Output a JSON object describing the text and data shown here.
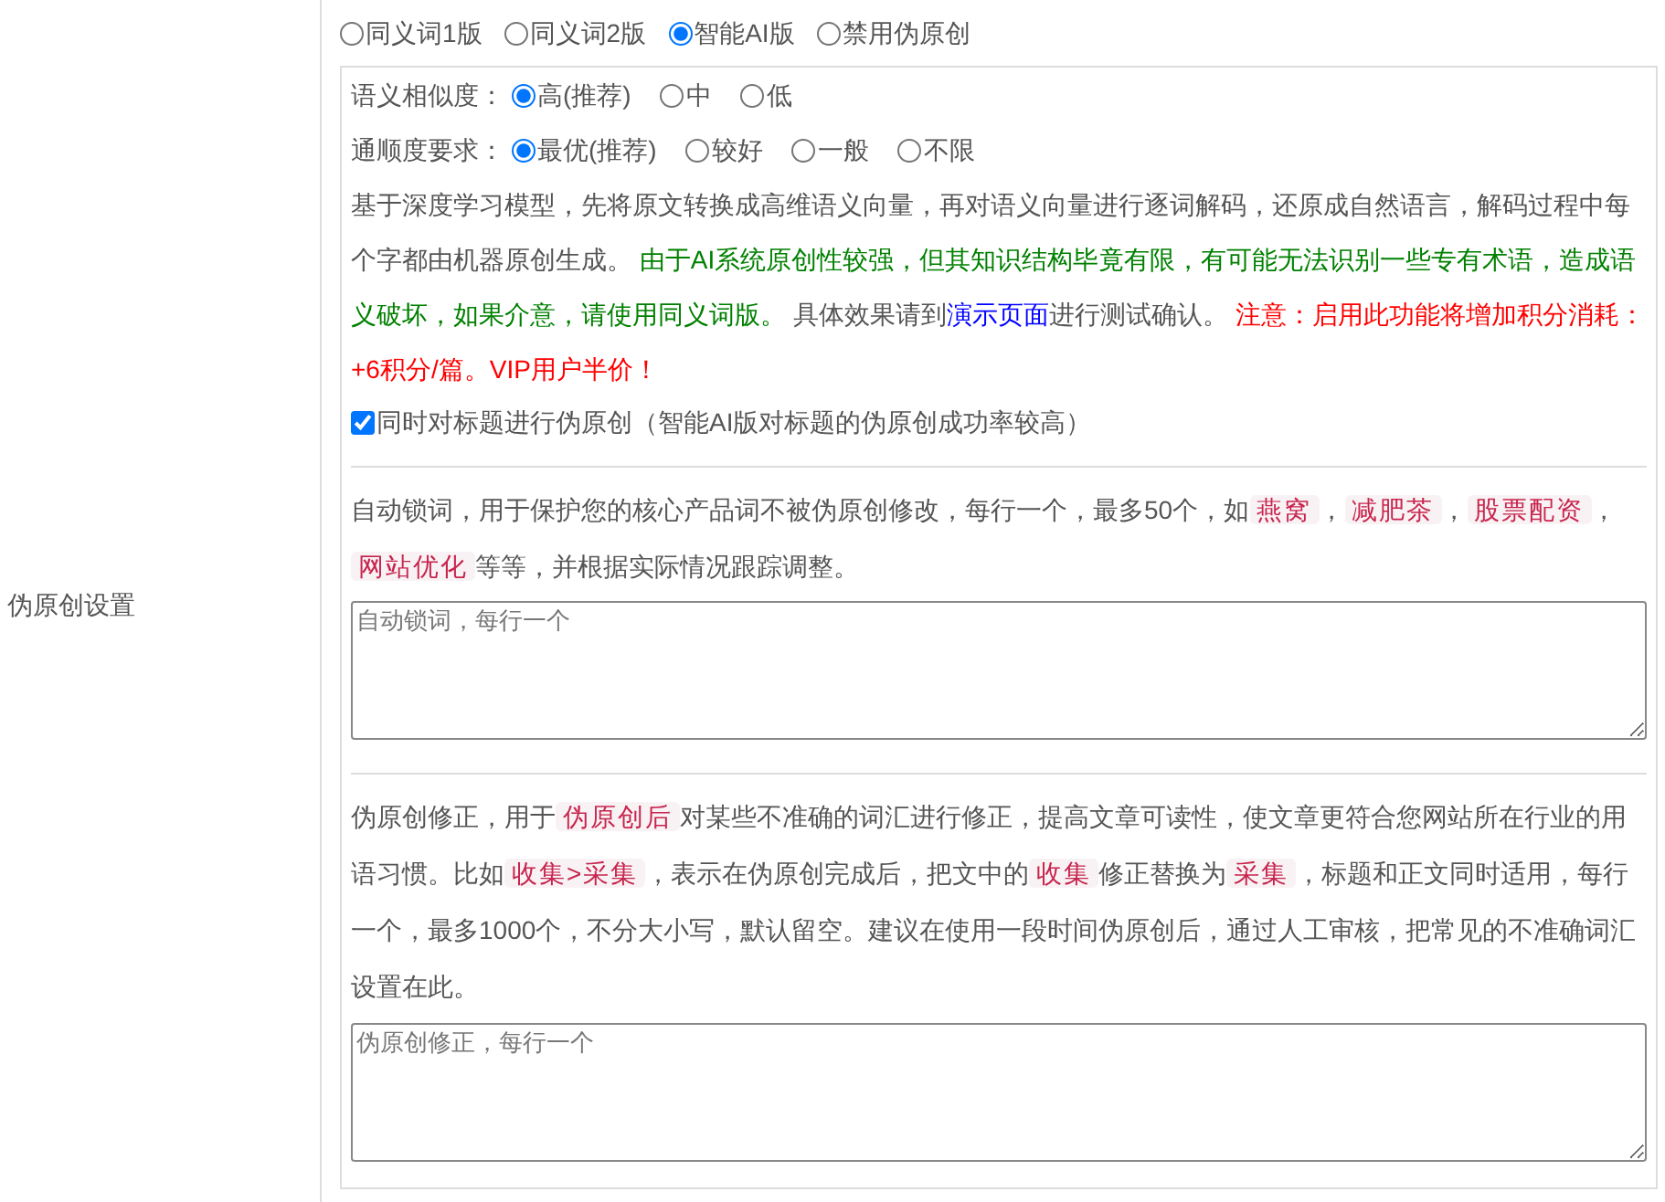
{
  "setting_label": "伪原创设置",
  "modes": [
    {
      "label": "同义词1版",
      "selected": false
    },
    {
      "label": "同义词2版",
      "selected": false
    },
    {
      "label": "智能AI版",
      "selected": true
    },
    {
      "label": "禁用伪原创",
      "selected": false
    }
  ],
  "ai_panel": {
    "option_groups": [
      {
        "label": "语义相似度：",
        "options": [
          {
            "label": "高(推荐)",
            "selected": true
          },
          {
            "label": "中",
            "selected": false
          },
          {
            "label": "低",
            "selected": false
          }
        ]
      },
      {
        "label": "通顺度要求：",
        "options": [
          {
            "label": "最优(推荐)",
            "selected": true
          },
          {
            "label": "较好",
            "selected": false
          },
          {
            "label": "一般",
            "selected": false
          },
          {
            "label": "不限",
            "selected": false
          }
        ]
      }
    ],
    "description": [
      {
        "kind": "text",
        "text": "基于深度学习模型，先将原文转换成高维语义向量，再对语义向量进行逐词解码，还原成自然语言，解码过程中每个字都由机器原创生成。 "
      },
      {
        "kind": "green",
        "text": "由于AI系统原创性较强，但其知识结构毕竟有限，有可能无法识别一些专有术语，造成语义破坏，如果介意，请使用同义词版。"
      },
      {
        "kind": "text",
        "text": " 具体效果请到"
      },
      {
        "kind": "link",
        "text": "演示页面"
      },
      {
        "kind": "text",
        "text": "进行测试确认。 "
      },
      {
        "kind": "red",
        "text": "注意：启用此功能将增加积分消耗：+6积分/篇。VIP用户半价！"
      }
    ],
    "title_checkbox": {
      "label": "同时对标题进行伪原创（智能AI版对标题的伪原创成功率较高）",
      "checked": true
    }
  },
  "lock_words": {
    "description": [
      {
        "kind": "text",
        "text": "自动锁词，用于保护您的核心产品词不被伪原创修改，每行一个，最多50个，如"
      },
      {
        "kind": "tag",
        "text": "燕窝"
      },
      {
        "kind": "text",
        "text": "，"
      },
      {
        "kind": "tag",
        "text": "减肥茶"
      },
      {
        "kind": "text",
        "text": "，"
      },
      {
        "kind": "tag",
        "text": "股票配资"
      },
      {
        "kind": "text",
        "text": "，"
      },
      {
        "kind": "tag",
        "text": "网站优化"
      },
      {
        "kind": "text",
        "text": "等等，并根据实际情况跟踪调整。"
      }
    ],
    "textarea": {
      "placeholder": "自动锁词，每行一个"
    }
  },
  "corrections": {
    "description": [
      {
        "kind": "text",
        "text": "伪原创修正，用于"
      },
      {
        "kind": "tag",
        "text": "伪原创后"
      },
      {
        "kind": "text",
        "text": "对某些不准确的词汇进行修正，提高文章可读性，使文章更符合您网站所在行业的用语习惯。比如"
      },
      {
        "kind": "tag",
        "text": "收集>采集"
      },
      {
        "kind": "text",
        "text": "，表示在伪原创完成后，把文中的"
      },
      {
        "kind": "tag",
        "text": "收集"
      },
      {
        "kind": "text",
        "text": "修正替换为"
      },
      {
        "kind": "tag",
        "text": "采集"
      },
      {
        "kind": "text",
        "text": "，标题和正文同时适用，每行一个，最多1000个，不分大小写，默认留空。建议在使用一段时间伪原创后，通过人工审核，把常见的不准确词汇设置在此。"
      }
    ],
    "textarea": {
      "placeholder": "伪原创修正，每行一个"
    }
  }
}
